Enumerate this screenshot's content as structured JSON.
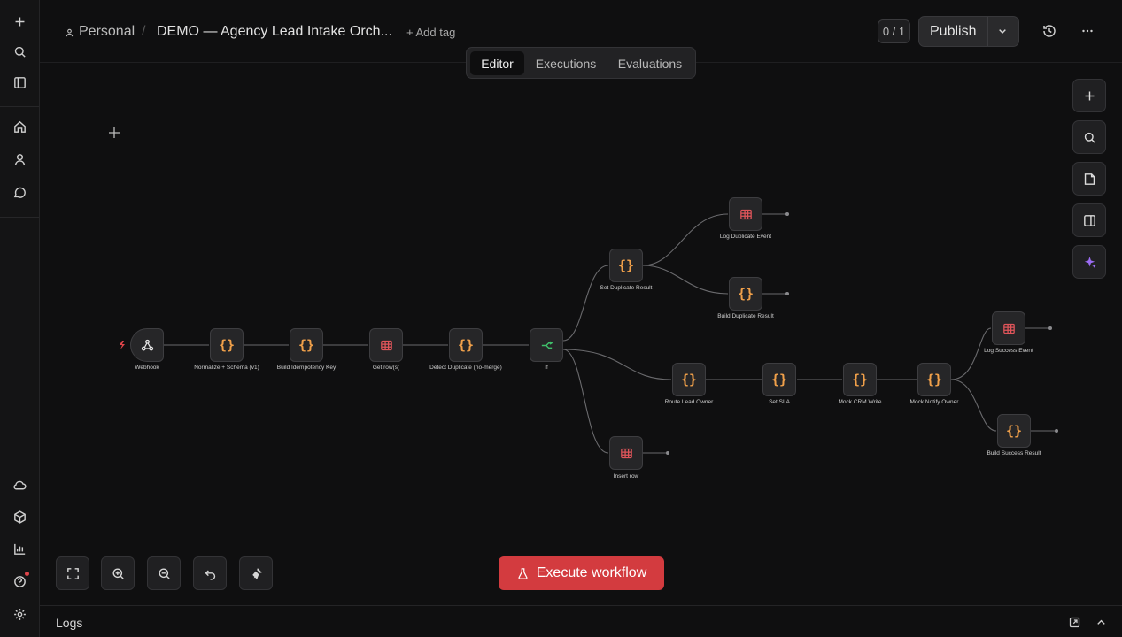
{
  "header": {
    "project": "Personal",
    "separator": "/",
    "workflow_title": "DEMO — Agency Lead Intake Orch...",
    "add_tag": "+ Add tag",
    "counter": "0 / 1",
    "publish_label": "Publish"
  },
  "tabs": [
    {
      "label": "Editor",
      "active": true
    },
    {
      "label": "Executions",
      "active": false
    },
    {
      "label": "Evaluations",
      "active": false
    }
  ],
  "nodes": {
    "webhook": "Webhook",
    "normalize": "Normalize + Schema (v1)",
    "idempotency": "Build Idempotency Key",
    "get_rows": "Get row(s)",
    "detect_duplicate": "Detect Duplicate (no-merge)",
    "if": "If",
    "set_duplicate": "Set Duplicate Result",
    "log_duplicate": "Log Duplicate Event",
    "build_duplicate": "Build Duplicate Result",
    "route_owner": "Route Lead Owner",
    "set_sla": "Set SLA",
    "mock_crm": "Mock CRM Write",
    "mock_notify": "Mock Notify Owner",
    "log_success": "Log Success Event",
    "build_success": "Build Success Result",
    "insert_row": "Insert row"
  },
  "execute_label": "Execute workflow",
  "logs_label": "Logs",
  "colors": {
    "accent_red": "#d33b3f",
    "code_orange": "#f0a04a",
    "table_red": "#e0555a",
    "if_green": "#3fbf6a",
    "ai_purple": "#9b6cf2"
  },
  "icons": {
    "rail": [
      "plus-icon",
      "search-icon",
      "sidebar-icon",
      "home-icon",
      "user-icon",
      "chat-icon",
      "cloud-icon",
      "package-icon",
      "chart-icon",
      "help-icon",
      "settings-icon"
    ],
    "node_types": [
      "webhook-icon",
      "code-icon",
      "table-icon",
      "if-icon"
    ]
  }
}
